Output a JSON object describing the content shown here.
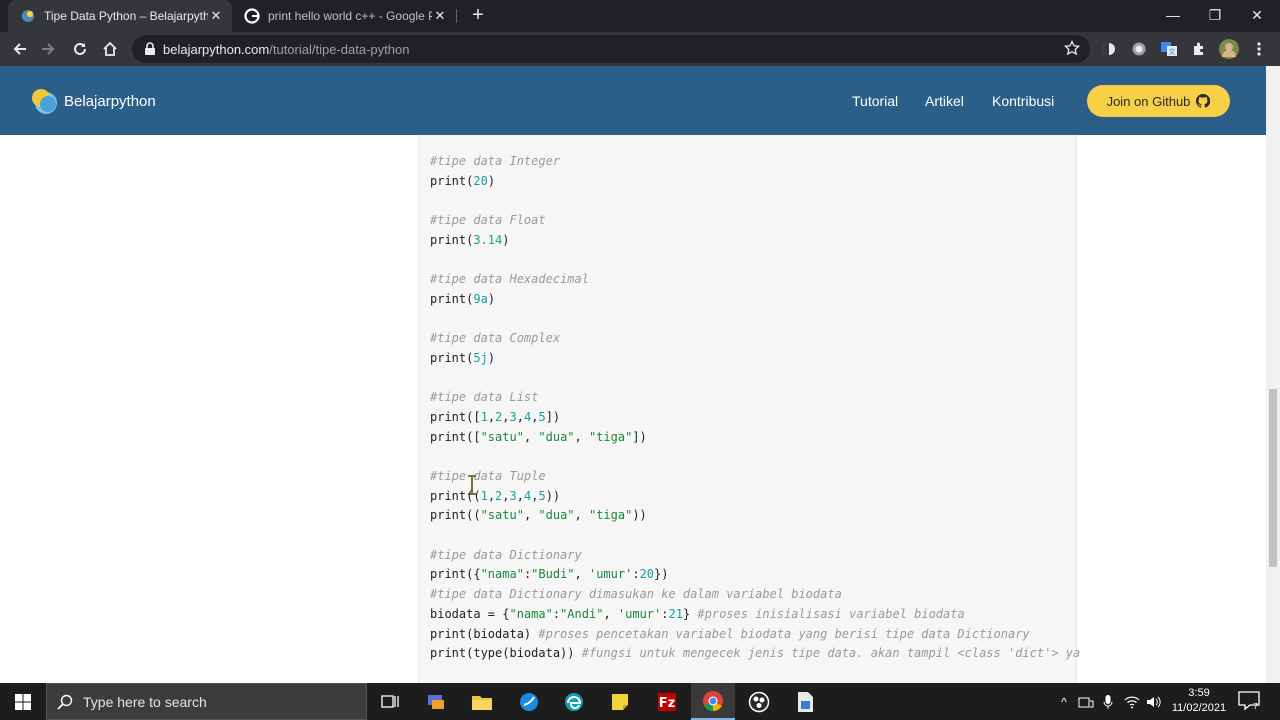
{
  "browser": {
    "tabs": [
      {
        "title": "Tipe Data Python – Belajarpython",
        "active": true
      },
      {
        "title": "print hello world c++ - Google P",
        "active": false
      }
    ],
    "url_host": "belajarpython.com",
    "url_path": "/tutorial/tipe-data-python"
  },
  "site": {
    "brand": "Belajarpython",
    "nav": [
      "Tutorial",
      "Artikel",
      "Kontribusi"
    ],
    "cta": "Join on Github",
    "colors": {
      "navbar": "#2b5f8a",
      "cta": "#f7d046"
    }
  },
  "code_lines": [
    [
      [
        "c-com",
        "#tipe data Integer"
      ]
    ],
    [
      [
        "c-fn",
        "print("
      ],
      [
        "c-num",
        "20"
      ],
      [
        "c-fn",
        ")"
      ]
    ],
    [],
    [
      [
        "c-com",
        "#tipe data Float"
      ]
    ],
    [
      [
        "c-fn",
        "print("
      ],
      [
        "c-num",
        "3.14"
      ],
      [
        "c-fn",
        ")"
      ]
    ],
    [],
    [
      [
        "c-com",
        "#tipe data Hexadecimal"
      ]
    ],
    [
      [
        "c-fn",
        "print("
      ],
      [
        "c-num",
        "9a"
      ],
      [
        "c-fn",
        ")"
      ]
    ],
    [],
    [
      [
        "c-com",
        "#tipe data Complex"
      ]
    ],
    [
      [
        "c-fn",
        "print("
      ],
      [
        "c-num",
        "5j"
      ],
      [
        "c-fn",
        ")"
      ]
    ],
    [],
    [
      [
        "c-com",
        "#tipe data List"
      ]
    ],
    [
      [
        "c-fn",
        "print(["
      ],
      [
        "c-num",
        "1"
      ],
      [
        "c-fn",
        ","
      ],
      [
        "c-num",
        "2"
      ],
      [
        "c-fn",
        ","
      ],
      [
        "c-num",
        "3"
      ],
      [
        "c-fn",
        ","
      ],
      [
        "c-num",
        "4"
      ],
      [
        "c-fn",
        ","
      ],
      [
        "c-num",
        "5"
      ],
      [
        "c-fn",
        "])"
      ]
    ],
    [
      [
        "c-fn",
        "print(["
      ],
      [
        "c-str",
        "\"satu\""
      ],
      [
        "c-fn",
        ", "
      ],
      [
        "c-str",
        "\"dua\""
      ],
      [
        "c-fn",
        ", "
      ],
      [
        "c-str",
        "\"tiga\""
      ],
      [
        "c-fn",
        "])"
      ]
    ],
    [],
    [
      [
        "c-com",
        "#tipe data Tuple"
      ]
    ],
    [
      [
        "c-fn",
        "print(("
      ],
      [
        "c-num",
        "1"
      ],
      [
        "c-fn",
        ","
      ],
      [
        "c-num",
        "2"
      ],
      [
        "c-fn",
        ","
      ],
      [
        "c-num",
        "3"
      ],
      [
        "c-fn",
        ","
      ],
      [
        "c-num",
        "4"
      ],
      [
        "c-fn",
        ","
      ],
      [
        "c-num",
        "5"
      ],
      [
        "c-fn",
        "))"
      ]
    ],
    [
      [
        "c-fn",
        "print(("
      ],
      [
        "c-str",
        "\"satu\""
      ],
      [
        "c-fn",
        ", "
      ],
      [
        "c-str",
        "\"dua\""
      ],
      [
        "c-fn",
        ", "
      ],
      [
        "c-str",
        "\"tiga\""
      ],
      [
        "c-fn",
        "))"
      ]
    ],
    [],
    [
      [
        "c-com",
        "#tipe data Dictionary"
      ]
    ],
    [
      [
        "c-fn",
        "print({"
      ],
      [
        "c-str",
        "\"nama\""
      ],
      [
        "c-fn",
        ":"
      ],
      [
        "c-str",
        "\"Budi\""
      ],
      [
        "c-fn",
        ", "
      ],
      [
        "c-str",
        "'umur'"
      ],
      [
        "c-fn",
        ":"
      ],
      [
        "c-num",
        "20"
      ],
      [
        "c-fn",
        "})"
      ]
    ],
    [
      [
        "c-com",
        "#tipe data Dictionary dimasukan ke dalam variabel biodata"
      ]
    ],
    [
      [
        "c-fn",
        "biodata = {"
      ],
      [
        "c-str",
        "\"nama\""
      ],
      [
        "c-fn",
        ":"
      ],
      [
        "c-str",
        "\"Andi\""
      ],
      [
        "c-fn",
        ", "
      ],
      [
        "c-str",
        "'umur'"
      ],
      [
        "c-fn",
        ":"
      ],
      [
        "c-num",
        "21"
      ],
      [
        "c-fn",
        "} "
      ],
      [
        "c-com",
        "#proses inisialisasi variabel biodata"
      ]
    ],
    [
      [
        "c-fn",
        "print(biodata) "
      ],
      [
        "c-com",
        "#proses pencetakan variabel biodata yang berisi tipe data Dictionary"
      ]
    ],
    [
      [
        "c-fn",
        "print(type(biodata)) "
      ],
      [
        "c-com",
        "#fungsi untuk mengecek jenis tipe data. akan tampil <class 'dict'> ya"
      ]
    ]
  ],
  "taskbar": {
    "search_placeholder": "Type here to search",
    "time": "3:59",
    "date": "11/02/2021"
  }
}
